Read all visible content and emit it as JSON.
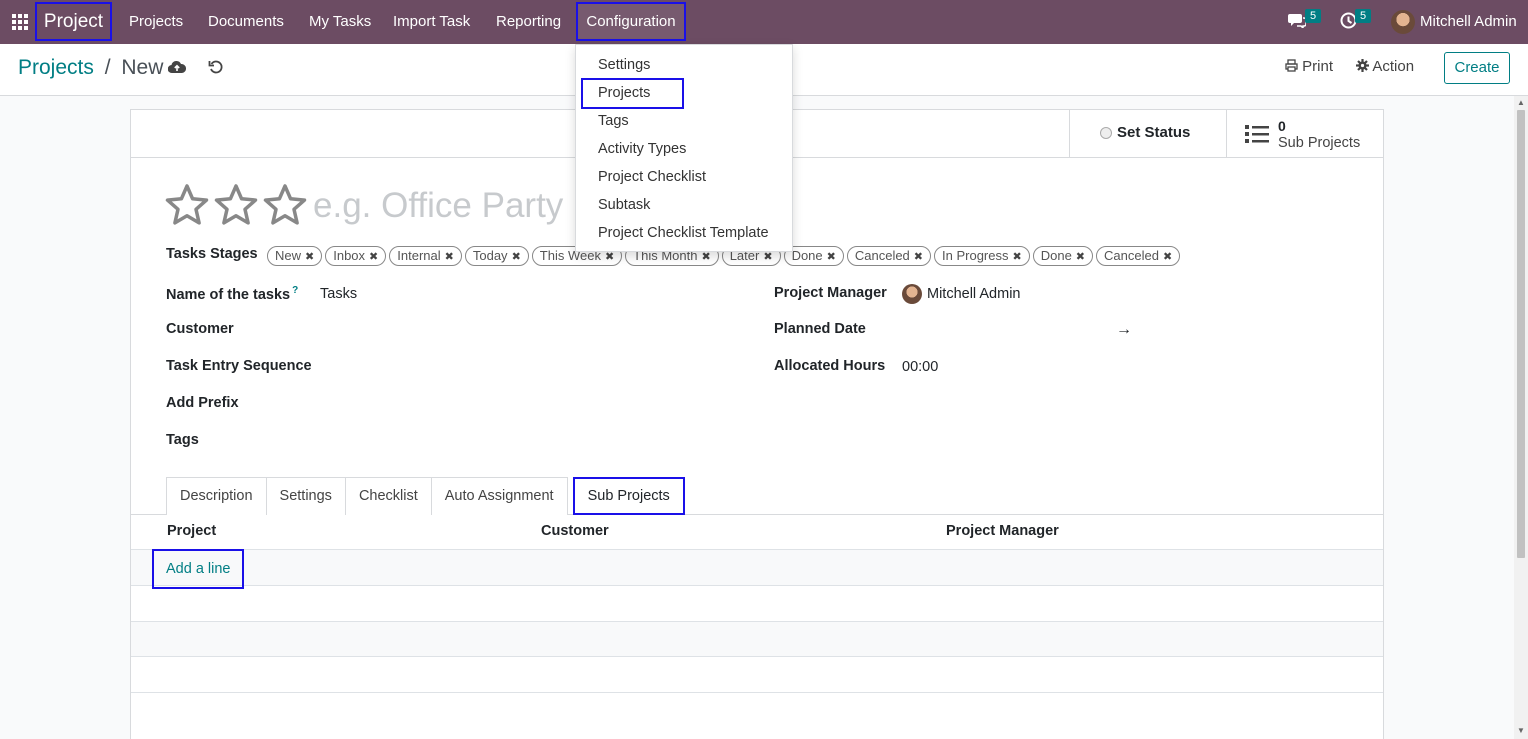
{
  "navbar": {
    "brand": "Project",
    "items": [
      "Projects",
      "Documents",
      "My Tasks",
      "Import Task",
      "Reporting"
    ],
    "configuration": "Configuration",
    "messages_count": "5",
    "activities_count": "5",
    "user_name": "Mitchell Admin"
  },
  "control_panel": {
    "breadcrumb_parent": "Projects",
    "breadcrumb_sep": "/",
    "breadcrumb_current": "New",
    "print_label": "Print",
    "action_label": "Action",
    "create_label": "Create"
  },
  "config_menu": {
    "items": [
      "Settings",
      "Projects",
      "Tags",
      "Activity Types",
      "Project Checklist",
      "Subtask",
      "Project Checklist Template"
    ]
  },
  "statusbar": {
    "set_status_label": "Set Status",
    "sub_projects_count": "0",
    "sub_projects_label": "Sub Projects"
  },
  "form": {
    "name_placeholder": "e.g. Office Party",
    "task_stages_label": "Tasks Stages",
    "task_stages": [
      "New",
      "Inbox",
      "Internal",
      "Today",
      "This Week",
      "This Month",
      "Later",
      "Done",
      "Canceled",
      "In Progress",
      "Done",
      "Canceled"
    ],
    "name_of_tasks_label": "Name of the tasks",
    "name_of_tasks_help": "?",
    "name_of_tasks_value": "Tasks",
    "customer_label": "Customer",
    "task_entry_sequence_label": "Task Entry Sequence",
    "add_prefix_label": "Add Prefix",
    "tags_label": "Tags",
    "project_manager_label": "Project Manager",
    "project_manager_value": "Mitchell Admin",
    "planned_date_label": "Planned Date",
    "planned_date_arrow": "→",
    "allocated_hours_label": "Allocated Hours",
    "allocated_hours_value": "00:00"
  },
  "tabs": [
    "Description",
    "Settings",
    "Checklist",
    "Auto Assignment",
    "Sub Projects"
  ],
  "sub_projects_table": {
    "headers": [
      "Project",
      "Customer",
      "Project Manager"
    ],
    "add_line": "Add a line"
  },
  "colors": {
    "navbar": "#6c4c63",
    "accent": "#017e84",
    "highlight": "#1a10e8"
  }
}
